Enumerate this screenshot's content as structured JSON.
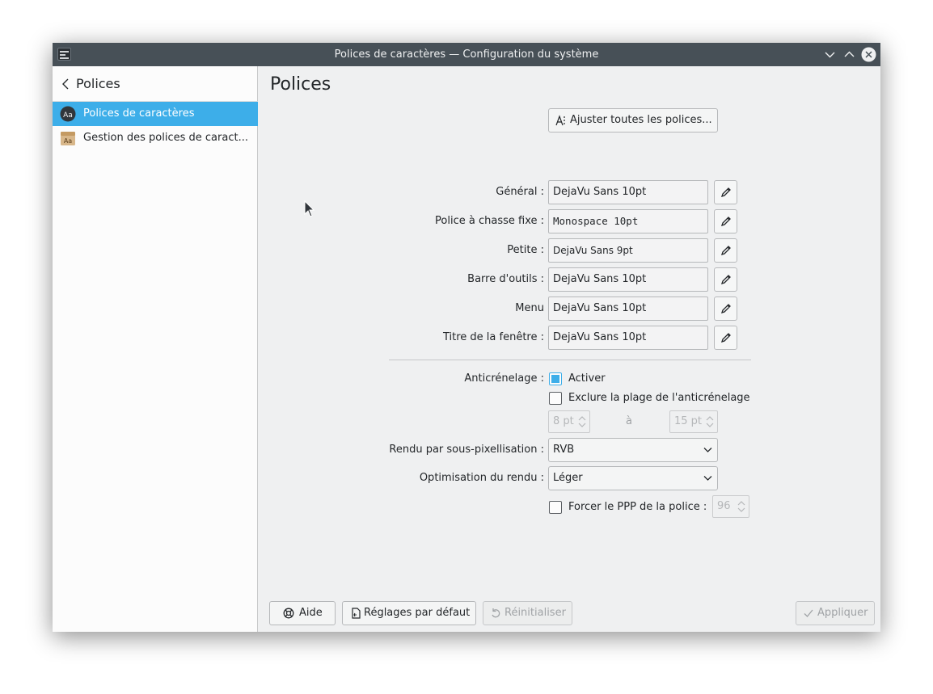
{
  "window": {
    "title": "Polices de caractères — Configuration du système"
  },
  "sidebar": {
    "back_title": "Polices",
    "items": [
      {
        "label": "Polices de caractères",
        "selected": true,
        "icon": "font-aa-dark-icon"
      },
      {
        "label": "Gestion des polices de caract...",
        "selected": false,
        "icon": "font-package-icon"
      }
    ]
  },
  "main": {
    "page_title": "Polices",
    "adjust_all_button": "Ajuster toutes les polices...",
    "fonts": [
      {
        "label": "Général :",
        "value": "DejaVu Sans 10pt"
      },
      {
        "label": "Police à chasse fixe :",
        "value": "Monospace 10pt"
      },
      {
        "label": "Petite :",
        "value": "DejaVu Sans 9pt"
      },
      {
        "label": "Barre d'outils :",
        "value": "DejaVu Sans 10pt"
      },
      {
        "label": "Menu",
        "value": "DejaVu Sans 10pt"
      },
      {
        "label": "Titre de la fenêtre :",
        "value": "DejaVu Sans 10pt"
      }
    ],
    "antialiasing": {
      "label": "Anticrénelage :",
      "enable_label": "Activer",
      "enable_checked": true,
      "exclude_label": "Exclure la plage de l'anticrénelage",
      "exclude_checked": false,
      "range_from": "8 pt",
      "range_to_label": "à",
      "range_to": "15 pt"
    },
    "subpixel": {
      "label": "Rendu par sous-pixellisation :",
      "value": "RVB"
    },
    "hinting": {
      "label": "Optimisation du rendu :",
      "value": "Léger"
    },
    "force_dpi": {
      "label": "Forcer le PPP de la police :",
      "checked": false,
      "value": "96"
    }
  },
  "footer": {
    "help": "Aide",
    "defaults": "Réglages par défaut",
    "reset": "Réinitialiser",
    "apply": "Appliquer"
  },
  "colors": {
    "accent": "#3daee9",
    "titlebar": "#475057",
    "window_bg": "#eff0f1"
  }
}
